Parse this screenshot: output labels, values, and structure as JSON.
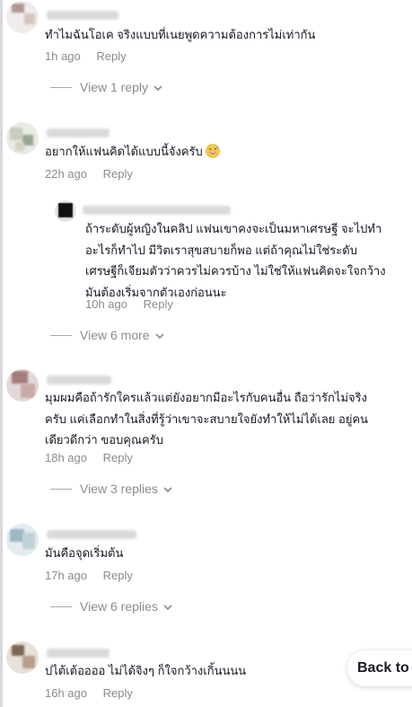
{
  "comments": [
    {
      "text_lines": [
        "ทำไมฉันโอเค จริงแบบที่เนยพูดความต้องการไม่เท่ากัน"
      ],
      "time": "1h ago",
      "reply_label": "Reply",
      "view_label": "View 1 reply"
    },
    {
      "text_lines": [
        "อยากให้แฟนคิดได้แบบนี้จังครับ"
      ],
      "emoji": "grinning-sweat-emoji",
      "time": "22h ago",
      "reply_label": "Reply"
    },
    {
      "text_lines": [
        "มุมผมคือถ้ารักใครแล้วแต่ยังอยากมีอะไรกับคนอื่น ถือว่ารักไม่จริง",
        "ครับ แค่เลือกทำในสิ่งที่รู้ว่าเขาจะสบายใจยังทำให้ไม่ได้เลย อยู่คน",
        "เดียวดีกว่า ขอบคุณครับ"
      ],
      "time": "18h ago",
      "reply_label": "Reply",
      "view_label": "View 3 replies"
    },
    {
      "text_lines": [
        "มันคือจุดเริ่มต้น"
      ],
      "time": "17h ago",
      "reply_label": "Reply",
      "view_label": "View 6 replies"
    },
    {
      "text_lines": [
        "ปไต้เต้ออออ ไม่ได้จิงๆ ก็ใจกว้างเกิ้นนนน"
      ],
      "time": "16h ago",
      "reply_label": "Reply"
    }
  ],
  "reply": {
    "text_lines": [
      "ถ้าระดับผู้หญิงในคลิป แฟนเขาคงจะเป็นมหาเศรษฐี จะไปทำ",
      "อะไรก็ทำไป มีวิตเราสุขสบายก็พอ แต่ถ้าคุณไม่ใช่ระดับ",
      "เศรษฐีก็เจียมตัวว่าควรไม่ควรบ้าง ไม่ใช่ให้แฟนคิดจะใจกว้าง",
      "มันต้องเริ่มจากตัวเองก่อนนะ"
    ],
    "time": "10h ago",
    "reply_label": "Reply",
    "view_label": "View 6 more"
  },
  "back_button_label": "Back to"
}
